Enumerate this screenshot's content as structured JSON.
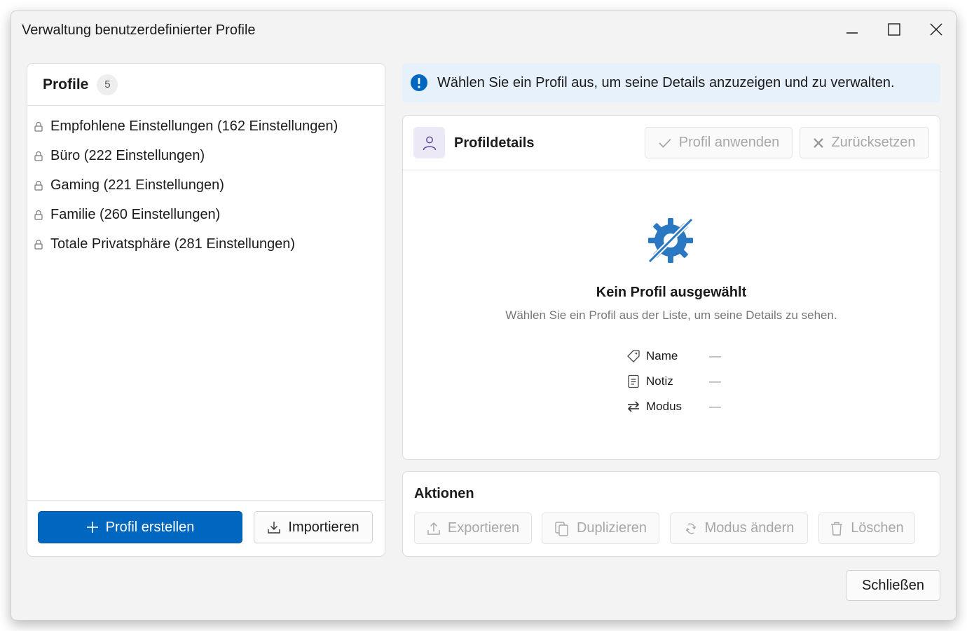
{
  "window": {
    "title": "Verwaltung benutzerdefinierter Profile",
    "controls": [
      "minimize-icon",
      "maximize-icon",
      "close-icon"
    ]
  },
  "profiles": {
    "title": "Profile",
    "count": "5",
    "items": [
      {
        "label": "Empfohlene Einstellungen (162 Einstellungen)",
        "icon": "lock-icon"
      },
      {
        "label": "Büro (222 Einstellungen)",
        "icon": "lock-icon"
      },
      {
        "label": "Gaming (221 Einstellungen)",
        "icon": "lock-icon"
      },
      {
        "label": "Familie (260 Einstellungen)",
        "icon": "lock-icon"
      },
      {
        "label": "Totale Privatsphäre (281 Einstellungen)",
        "icon": "lock-icon"
      }
    ],
    "create_label": "Profil erstellen",
    "import_label": "Importieren"
  },
  "info": {
    "text": "Wählen Sie ein Profil aus, um seine Details anzuzeigen und zu verwalten.",
    "icon": "info-icon"
  },
  "details": {
    "title": "Profildetails",
    "apply_label": "Profil anwenden",
    "reset_label": "Zurücksetzen",
    "empty_title": "Kein Profil ausgewählt",
    "empty_subtitle": "Wählen Sie ein Profil aus der Liste, um seine Details zu sehen.",
    "fields": [
      {
        "label": "Name",
        "value": "—",
        "icon": "tag-icon"
      },
      {
        "label": "Notiz",
        "value": "—",
        "icon": "note-icon"
      },
      {
        "label": "Modus",
        "value": "—",
        "icon": "swap-icon"
      }
    ]
  },
  "actions": {
    "title": "Aktionen",
    "export_label": "Exportieren",
    "duplicate_label": "Duplizieren",
    "change_mode_label": "Modus ändern",
    "delete_label": "Löschen"
  },
  "footer": {
    "close_label": "Schließen"
  },
  "colors": {
    "accent": "#0067c0",
    "info_background": "#e7f1fb",
    "info_icon": "#0067c0",
    "avatar_background": "#ece8f6",
    "avatar_icon": "#5b4a9e",
    "disabled_text": "#a7a7a7"
  }
}
